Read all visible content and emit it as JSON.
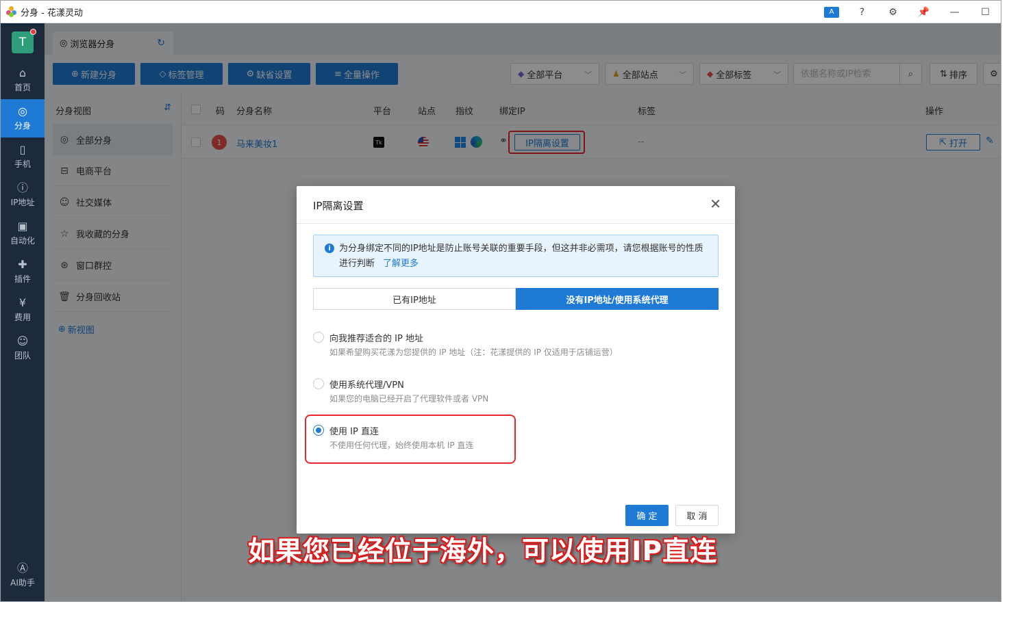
{
  "window": {
    "title": "分身 - 花漾灵动",
    "icons": [
      "translate-icon",
      "help-icon",
      "settings-icon",
      "pin-icon",
      "minimize-icon",
      "maximize-icon"
    ],
    "translate_label": "A"
  },
  "sidebar": {
    "avatar_letter": "T",
    "items": [
      {
        "label": "首页",
        "icon": "home-icon"
      },
      {
        "label": "分身",
        "icon": "browser-icon",
        "active": true
      },
      {
        "label": "手机",
        "icon": "phone-icon"
      },
      {
        "label": "IP地址",
        "icon": "ip-icon"
      },
      {
        "label": "自动化",
        "icon": "robot-icon"
      },
      {
        "label": "插件",
        "icon": "plugin-icon"
      },
      {
        "label": "费用",
        "icon": "yen-icon"
      },
      {
        "label": "团队",
        "icon": "team-icon"
      },
      {
        "label": "AI助手",
        "icon": "ai-icon"
      }
    ]
  },
  "tab": {
    "label": "浏览器分身"
  },
  "toolbar": {
    "new_label": "新建分身",
    "tags_label": "标签管理",
    "defaults_label": "缺省设置",
    "bulk_label": "全量操作",
    "platform_filter": "全部平台",
    "site_filter": "全部站点",
    "tag_filter": "全部标签",
    "search_placeholder": "依据名称或IP检索",
    "sort_label": "排序"
  },
  "left_panel": {
    "title": "分身视图",
    "items": [
      {
        "label": "全部分身",
        "active": true
      },
      {
        "label": "电商平台"
      },
      {
        "label": "社交媒体"
      },
      {
        "label": "我收藏的分身"
      },
      {
        "label": "窗口群控"
      },
      {
        "label": "分身回收站"
      }
    ],
    "new_view": "新视图"
  },
  "table": {
    "headers": [
      "码",
      "分身名称",
      "平台",
      "站点",
      "指纹",
      "绑定IP",
      "标签",
      "操作"
    ],
    "rows": [
      {
        "code": "1",
        "name": "马来美妆1",
        "platform": "Tk",
        "site": "us-flag-icon",
        "fingerprint": "windows-edge",
        "ip_button": "IP隔离设置",
        "tags": "--",
        "open_label": "打开"
      }
    ]
  },
  "modal": {
    "title": "IP隔离设置",
    "alert_text": "为分身绑定不同的IP地址是防止账号关联的重要手段，但这并非必需项，请您根据账号的性质进行判断",
    "alert_link": "了解更多",
    "tabs": [
      "已有IP地址",
      "没有IP地址/使用系统代理"
    ],
    "active_tab": 1,
    "options": [
      {
        "title": "向我推荐适合的 IP 地址",
        "desc": "如果希望购买花漾为您提供的 IP 地址（注：花漾提供的 IP 仅适用于店铺运营）",
        "checked": false
      },
      {
        "title": "使用系统代理/VPN",
        "desc": "如果您的电脑已经开启了代理软件或者 VPN",
        "checked": false
      },
      {
        "title": "使用 IP 直连",
        "desc": "不使用任何代理，始终使用本机 IP 直连",
        "checked": true
      }
    ],
    "ok_label": "确 定",
    "cancel_label": "取 消"
  },
  "caption": "如果您已经位于海外，可以使用IP直连",
  "colors": {
    "accent": "#1f7ad6",
    "sidebar": "#1d2a3c",
    "highlight": "#e5262c"
  }
}
